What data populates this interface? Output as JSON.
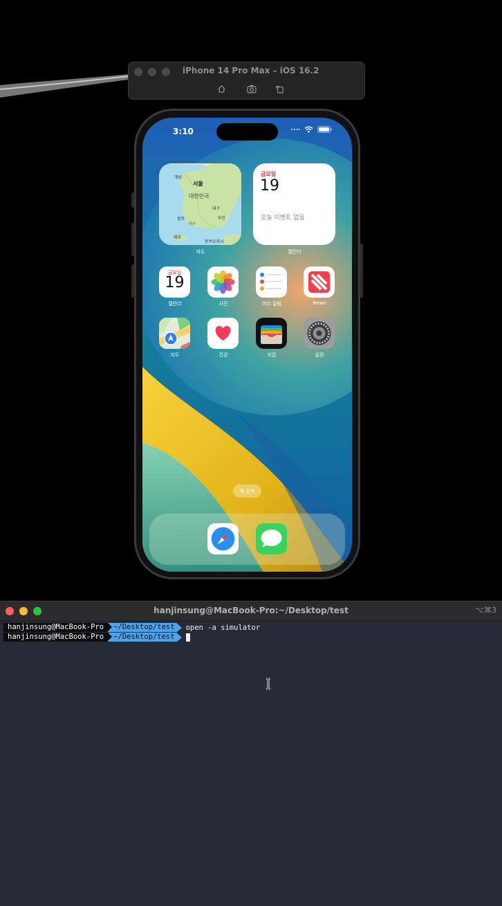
{
  "simulator": {
    "title": "iPhone 14 Pro Max – iOS 16.2",
    "buttons": [
      "home-icon",
      "screenshot-icon",
      "rotate-icon"
    ]
  },
  "phone": {
    "status_time": "3:10",
    "widgets": {
      "map": {
        "label": "지도",
        "places": [
          "개성",
          "서울",
          "대한민국",
          "대구",
          "광주",
          "부산",
          "여수",
          "제주",
          "후쿠오카시"
        ]
      },
      "calendar": {
        "label": "캘린더",
        "day_name": "금요일",
        "date": "19",
        "no_events": "오늘 이벤트 없음"
      }
    },
    "apps_row1": [
      {
        "label": "캘린더",
        "icon": "calendar-app-icon",
        "day": "금요일",
        "date": "19"
      },
      {
        "label": "사진",
        "icon": "photos-app-icon"
      },
      {
        "label": "미리 알림",
        "icon": "reminders-app-icon"
      },
      {
        "label": "News",
        "icon": "news-app-icon"
      }
    ],
    "apps_row2": [
      {
        "label": "지도",
        "icon": "maps-app-icon"
      },
      {
        "label": "건강",
        "icon": "health-app-icon"
      },
      {
        "label": "지갑",
        "icon": "wallet-app-icon"
      },
      {
        "label": "설정",
        "icon": "settings-app-icon"
      }
    ],
    "search_label": "검색",
    "dock": [
      "safari-app-icon",
      "messages-app-icon"
    ]
  },
  "terminal": {
    "title": "hanjinsung@MacBook-Pro:~/Desktop/test",
    "shortcut": "⌥⌘3",
    "lines": [
      {
        "user": "hanjinsung@MacBook-Pro",
        "path": "~/Desktop/test",
        "command": "open -a simulator"
      },
      {
        "user": "hanjinsung@MacBook-Pro",
        "path": "~/Desktop/test",
        "command": ""
      }
    ]
  }
}
